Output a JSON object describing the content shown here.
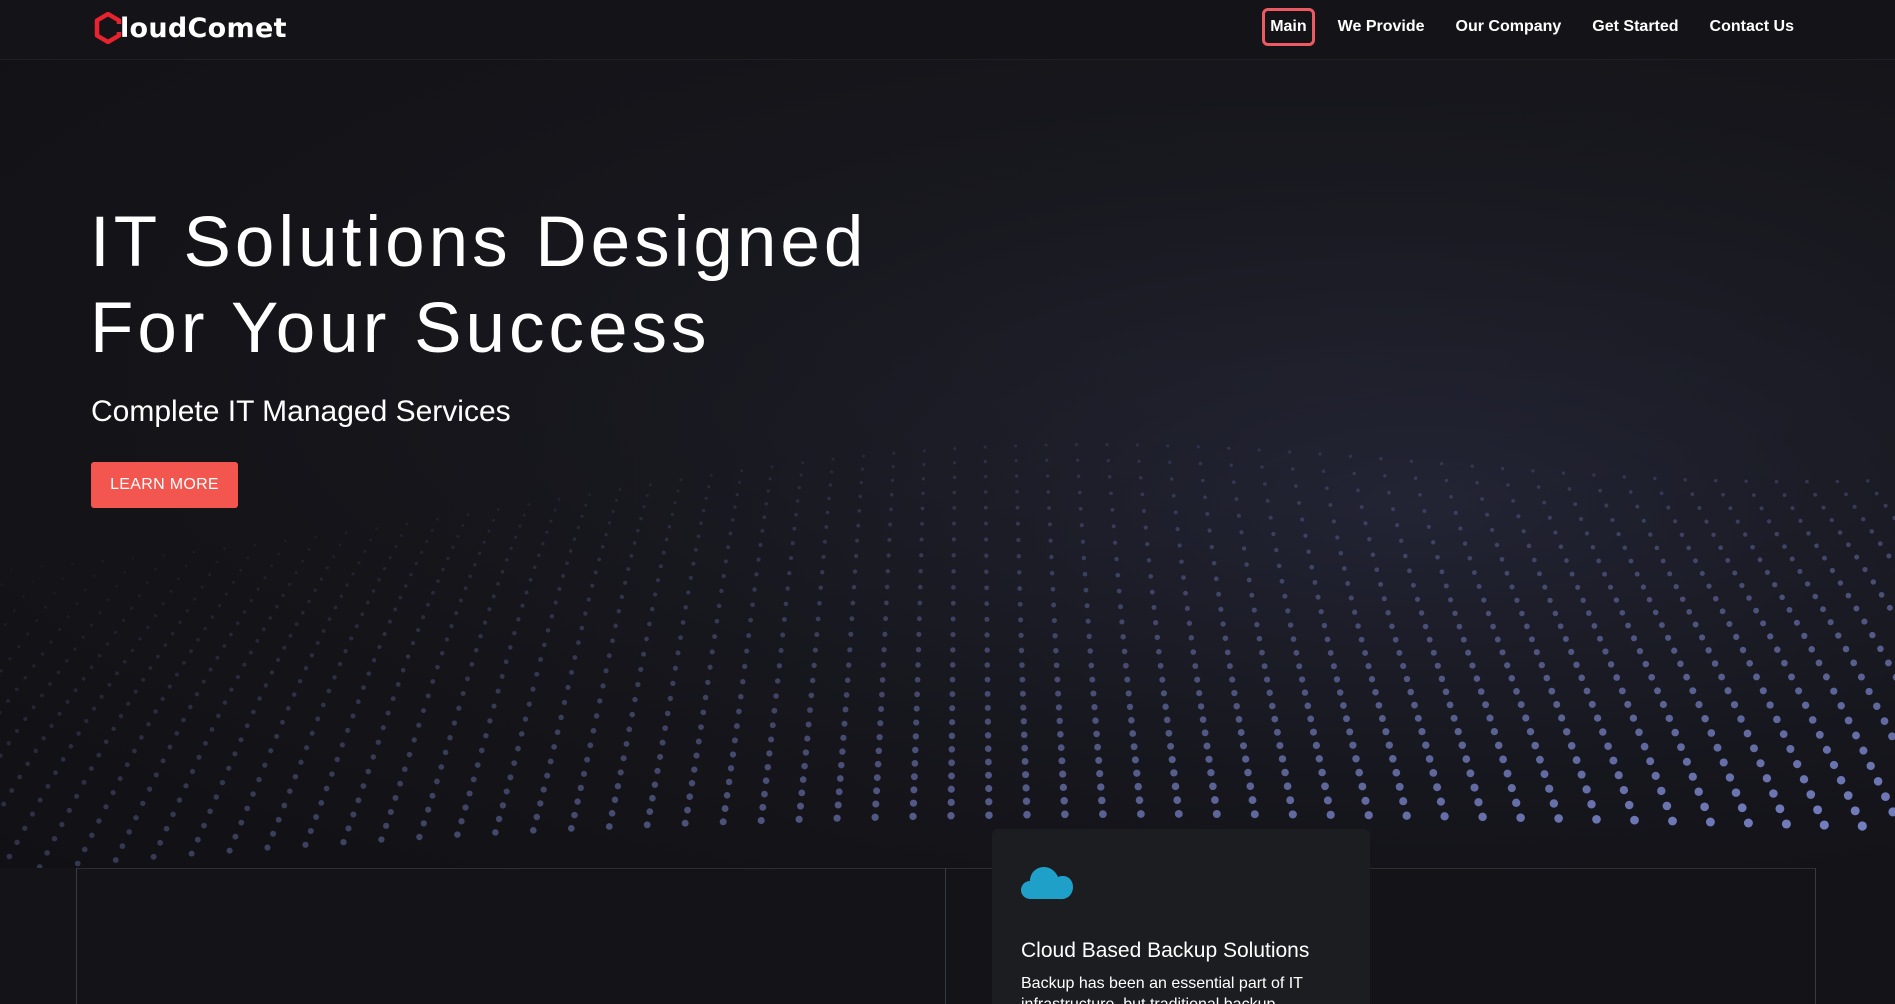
{
  "brand": {
    "name": "loudComet",
    "logo_icon": "hexagon-c-logo",
    "accent_color": "#e8232f"
  },
  "nav": {
    "items": [
      {
        "label": "Main",
        "active": true
      },
      {
        "label": "We Provide",
        "active": false
      },
      {
        "label": "Our Company",
        "active": false
      },
      {
        "label": "Get Started",
        "active": false
      },
      {
        "label": "Contact Us",
        "active": false
      }
    ]
  },
  "hero": {
    "title_line1": "IT Solutions Designed",
    "title_line2": "For Your Success",
    "subtitle": "Complete IT Managed Services",
    "button_label": "LEARN MORE",
    "button_color": "#f2564f"
  },
  "service_card": {
    "icon": "cloud-icon",
    "icon_color": "#1fa0c9",
    "title": "Cloud Based Backup Solutions",
    "text": "Backup has been an essential part of IT infrastructure, but traditional backup"
  }
}
